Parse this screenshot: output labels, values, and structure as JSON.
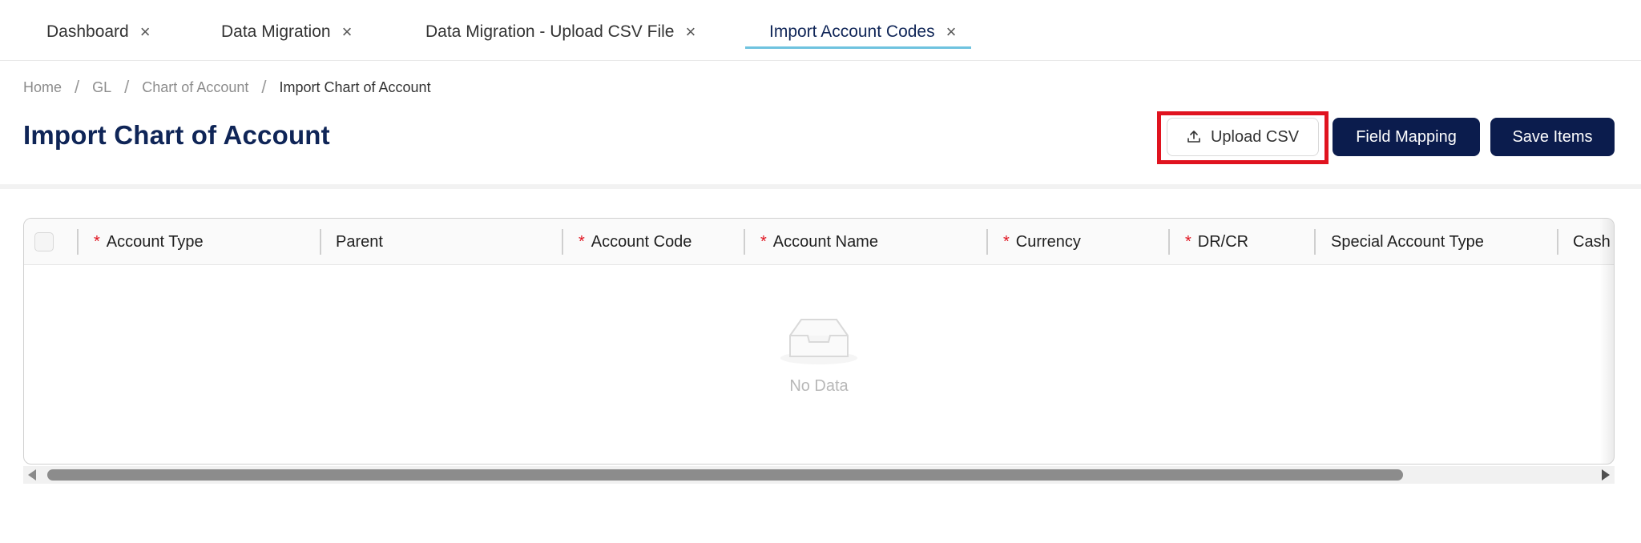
{
  "tabs": [
    {
      "label": "Dashboard",
      "close": "×"
    },
    {
      "label": "Data Migration",
      "close": "×"
    },
    {
      "label": "Data Migration - Upload CSV File",
      "close": "×"
    },
    {
      "label": "Import Account Codes",
      "close": "×",
      "active": true
    }
  ],
  "breadcrumb": {
    "items": [
      "Home",
      "GL",
      "Chart of Account",
      "Import Chart of Account"
    ],
    "separator": "/"
  },
  "page": {
    "title": "Import Chart of Account"
  },
  "actions": {
    "upload_label": "Upload CSV",
    "field_mapping_label": "Field Mapping",
    "save_label": "Save Items"
  },
  "table": {
    "columns": [
      {
        "label": "Account Type",
        "required": "*"
      },
      {
        "label": "Parent",
        "required": ""
      },
      {
        "label": "Account Code",
        "required": "*"
      },
      {
        "label": "Account Name",
        "required": "*"
      },
      {
        "label": "Currency",
        "required": "*"
      },
      {
        "label": "DR/CR",
        "required": "*"
      },
      {
        "label": "Special Account Type",
        "required": ""
      },
      {
        "label": "Cash",
        "required": ""
      }
    ],
    "empty_text": "No Data"
  },
  "colors": {
    "primary": "#0b1c4d",
    "title": "#0f2557",
    "tab_underline": "#6fc3df",
    "required": "#e0131f",
    "highlight": "#e0131f"
  }
}
